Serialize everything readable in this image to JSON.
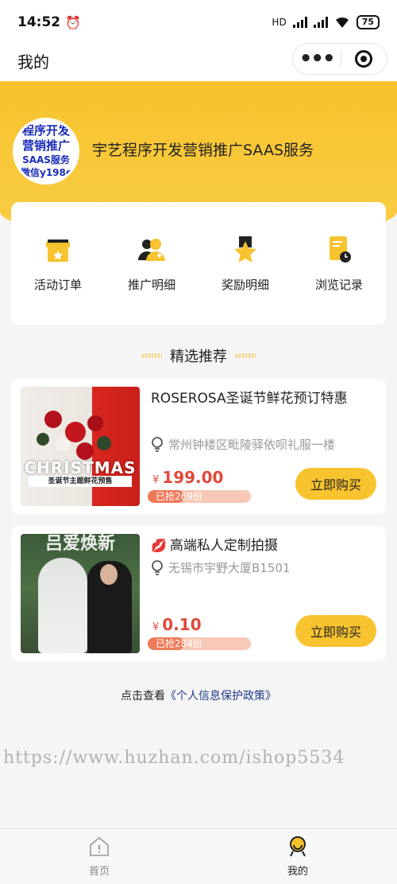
{
  "status": {
    "time": "14:52",
    "hd": "HD",
    "battery": "75"
  },
  "nav": {
    "title": "我的",
    "more": "•••"
  },
  "user": {
    "avatar_lines": [
      "程序开发",
      "营销推广",
      "SAAS服务",
      "微信y198c"
    ],
    "name": "宇艺程序开发营销推广SAAS服务"
  },
  "menu": [
    {
      "label": "活动订单",
      "icon": "gift-icon"
    },
    {
      "label": "推广明细",
      "icon": "users-plus-icon"
    },
    {
      "label": "奖励明细",
      "icon": "star-badge-icon"
    },
    {
      "label": "浏览记录",
      "icon": "history-doc-icon"
    }
  ],
  "section": {
    "title": "精选推荐"
  },
  "products": [
    {
      "title": "ROSEROSA圣诞节鲜花预订特惠",
      "location": "常州钟楼区毗陵驿依呗礼服一楼",
      "currency": "¥",
      "price": "199.00",
      "sold": "已抢269份",
      "sold_ratio": 0.35,
      "buy_label": "立即购买",
      "image_banner": "CHRISTMAS",
      "image_sub": "圣诞节主题鲜花预售"
    },
    {
      "title": "高端私人定制拍摄",
      "location": "无锡市宇野大厦B1501",
      "currency": "¥",
      "price": "0.10",
      "sold": "已抢284份",
      "sold_ratio": 0.35,
      "buy_label": "立即购买",
      "image_banner": "吕爱焕新"
    }
  ],
  "privacy": {
    "prefix": "点击查看",
    "link": "《个人信息保护政策》"
  },
  "watermark": "https://www.huzhan.com/ishop5534",
  "tabs": [
    {
      "label": "首页",
      "icon": "home-icon"
    },
    {
      "label": "我的",
      "icon": "profile-icon"
    }
  ],
  "colors": {
    "accent": "#f7c32e",
    "price": "#e04a3a",
    "link": "#1e3a8a"
  }
}
